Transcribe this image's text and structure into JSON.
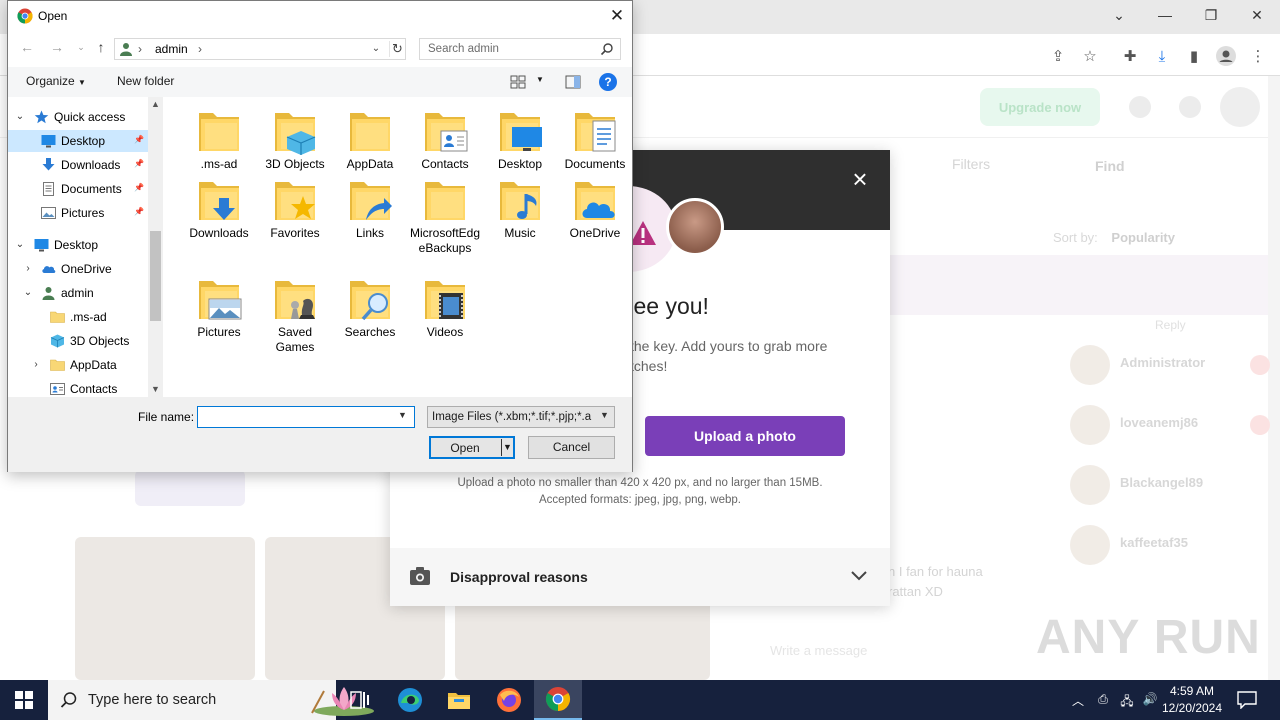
{
  "background_site": {
    "upgrade_label": "Upgrade now",
    "filters_label": "Filters",
    "find_label": "Find",
    "sort_label": "Sort by:",
    "sort_value": "Popularity",
    "reply_label": "Reply",
    "chats": [
      {
        "name": "Administrator"
      },
      {
        "name": "loveanemj86"
      },
      {
        "name": "Blackangel89"
      },
      {
        "name": "kaffeetaf35"
      }
    ],
    "message_line1": "n I fan for hauna",
    "message_line2": "rattan XD",
    "message_input_placeholder": "Write a message"
  },
  "modal": {
    "heading": "na see you!",
    "subtext_line1": "the key. Add yours to grab more",
    "subtext_line2": "tches!",
    "upload_button": "Upload a photo",
    "info_line1": "Upload a photo no smaller than 420 x 420 px, and no larger than 15MB.",
    "info_line2": "Accepted formats: jpeg, jpg, png, webp.",
    "disapproval_label": "Disapproval reasons"
  },
  "dialog": {
    "title": "Open",
    "address_crumb": "admin",
    "search_placeholder": "Search admin",
    "organize_label": "Organize",
    "new_folder_label": "New folder",
    "help_label": "?",
    "tree": [
      {
        "label": "Quick access",
        "icon": "star-icon",
        "level": 0,
        "expand": "open",
        "pinned": false,
        "selected": false
      },
      {
        "label": "Desktop",
        "icon": "desktop-icon",
        "level": 1,
        "expand": "",
        "pinned": true,
        "selected": true
      },
      {
        "label": "Downloads",
        "icon": "download-icon",
        "level": 1,
        "expand": "",
        "pinned": true,
        "selected": false
      },
      {
        "label": "Documents",
        "icon": "document-icon",
        "level": 1,
        "expand": "",
        "pinned": true,
        "selected": false
      },
      {
        "label": "Pictures",
        "icon": "pictures-icon",
        "level": 1,
        "expand": "",
        "pinned": true,
        "selected": false
      },
      {
        "label": "Desktop",
        "icon": "desktop-icon",
        "level": 0,
        "expand": "open",
        "pinned": false,
        "selected": false
      },
      {
        "label": "OneDrive",
        "icon": "cloud-icon",
        "level": 1,
        "expand": "closed",
        "pinned": false,
        "selected": false
      },
      {
        "label": "admin",
        "icon": "user-icon",
        "level": 1,
        "expand": "open",
        "pinned": false,
        "selected": false
      },
      {
        "label": ".ms-ad",
        "icon": "folder-icon",
        "level": 2,
        "expand": "",
        "pinned": false,
        "selected": false
      },
      {
        "label": "3D Objects",
        "icon": "cube-icon",
        "level": 2,
        "expand": "",
        "pinned": false,
        "selected": false
      },
      {
        "label": "AppData",
        "icon": "folder-icon",
        "level": 2,
        "expand": "closed",
        "pinned": false,
        "selected": false
      },
      {
        "label": "Contacts",
        "icon": "contacts-icon",
        "level": 2,
        "expand": "",
        "pinned": false,
        "selected": false
      }
    ],
    "files": [
      {
        "label": ".ms-ad",
        "overlay": "none"
      },
      {
        "label": "3D Objects",
        "overlay": "cube"
      },
      {
        "label": "AppData",
        "overlay": "none"
      },
      {
        "label": "Contacts",
        "overlay": "contacts"
      },
      {
        "label": "Desktop",
        "overlay": "desktop"
      },
      {
        "label": "Documents",
        "overlay": "document"
      },
      {
        "label": "Downloads",
        "overlay": "download"
      },
      {
        "label": "Favorites",
        "overlay": "star"
      },
      {
        "label": "Links",
        "overlay": "link"
      },
      {
        "label": "MicrosoftEdgeBackups",
        "overlay": "none"
      },
      {
        "label": "Music",
        "overlay": "music"
      },
      {
        "label": "OneDrive",
        "overlay": "cloud"
      },
      {
        "label": "Pictures",
        "overlay": "picture"
      },
      {
        "label": "Saved Games",
        "overlay": "chess"
      },
      {
        "label": "Searches",
        "overlay": "magnifier"
      },
      {
        "label": "Videos",
        "overlay": "film"
      }
    ],
    "file_name_label": "File name:",
    "file_name_value": "",
    "file_type_value": "Image Files (*.xbm;*.tif;*.pjp;*.a",
    "open_label": "Open",
    "cancel_label": "Cancel"
  },
  "watermark": "ANY RUN",
  "taskbar": {
    "search_placeholder": "Type here to search",
    "time": "4:59 AM",
    "date": "12/20/2024"
  },
  "colors": {
    "taskbar_bg": "#16213d",
    "accent_purple": "#7a3fb8",
    "selection_blue": "#cce8ff",
    "focus_blue": "#0078d7"
  }
}
